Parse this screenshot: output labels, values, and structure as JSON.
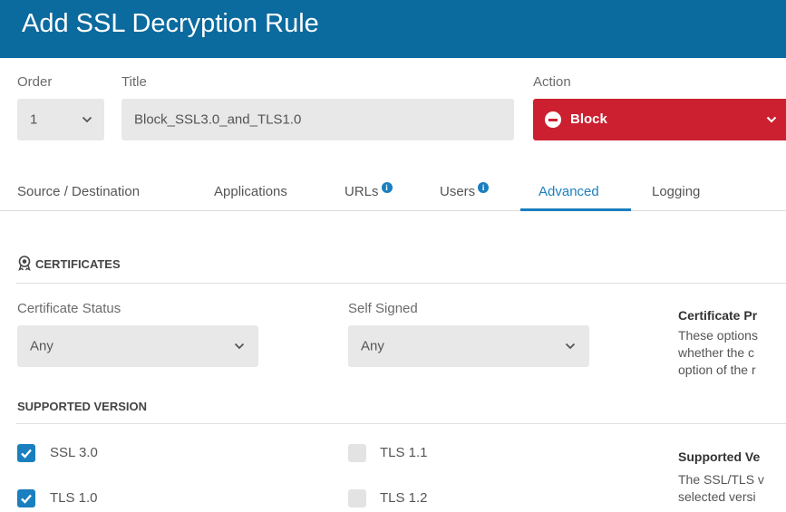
{
  "dialog": {
    "title": "Add SSL Decryption Rule"
  },
  "rule": {
    "order_label": "Order",
    "order_value": "1",
    "title_label": "Title",
    "title_value": "Block_SSL3.0_and_TLS1.0",
    "action_label": "Action",
    "action_value": "Block",
    "action_color": "#cc2030"
  },
  "tabs": [
    {
      "label": "Source / Destination",
      "info": false
    },
    {
      "label": "Applications",
      "info": false
    },
    {
      "label": "URLs",
      "info": true
    },
    {
      "label": "Users",
      "info": true
    },
    {
      "label": "Advanced",
      "info": false,
      "active": true
    },
    {
      "label": "Logging",
      "info": false
    }
  ],
  "info_glyph": "i",
  "certificates": {
    "heading": "CERTIFICATES",
    "icon": "certificate-badge-icon",
    "status_label": "Certificate Status",
    "status_value": "Any",
    "self_signed_label": "Self Signed",
    "self_signed_value": "Any"
  },
  "side_certificate": {
    "title": "Certificate Pr",
    "lines": [
      "These options",
      "whether the c",
      "option of the r"
    ]
  },
  "supported_version": {
    "heading": "SUPPORTED VERSION",
    "options": [
      {
        "label": "SSL 3.0",
        "checked": true
      },
      {
        "label": "TLS 1.1",
        "checked": false
      },
      {
        "label": "TLS 1.0",
        "checked": true
      },
      {
        "label": "TLS 1.2",
        "checked": false
      }
    ]
  },
  "side_supported": {
    "title": "Supported Ve",
    "lines": [
      "The SSL/TLS v",
      "selected versi"
    ]
  },
  "colors": {
    "header": "#0b6a9e",
    "accent": "#1a7fbf",
    "block": "#cc2030"
  }
}
